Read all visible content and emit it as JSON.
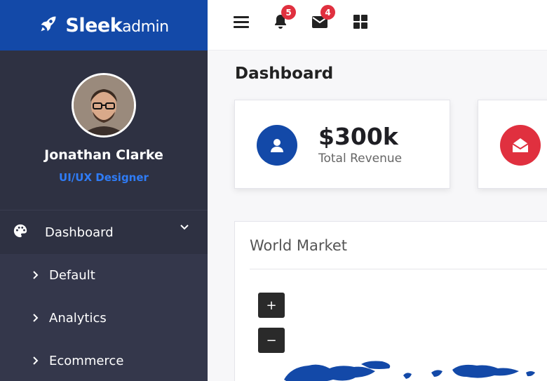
{
  "brand": {
    "name_big": "Sleek",
    "name_small": "admin",
    "icon": "rocket-icon",
    "color": "#1349a8"
  },
  "profile": {
    "name": "Jonathan Clarke",
    "role": "UI/UX Designer",
    "role_color": "#2f7cf6"
  },
  "nav": {
    "top": {
      "label": "Dashboard",
      "icon": "palette-icon"
    },
    "items": [
      {
        "label": "Default"
      },
      {
        "label": "Analytics"
      },
      {
        "label": "Ecommerce"
      }
    ]
  },
  "topbar": {
    "menu_icon": "hamburger-icon",
    "notifications": {
      "icon": "bell-icon",
      "count": "5"
    },
    "messages": {
      "icon": "envelope-icon",
      "count": "4"
    },
    "apps_icon": "grid-icon"
  },
  "page": {
    "title": "Dashboard"
  },
  "stats": [
    {
      "value": "$300k",
      "label": "Total Revenue",
      "icon": "user-icon",
      "color": "#1349a8"
    },
    {
      "value": "",
      "label": "",
      "icon": "envelope-open-icon",
      "color": "#e0303f"
    }
  ],
  "world_market": {
    "title": "World Market",
    "zoom_in": "+",
    "zoom_out": "−",
    "map_color": "#1349a8"
  }
}
